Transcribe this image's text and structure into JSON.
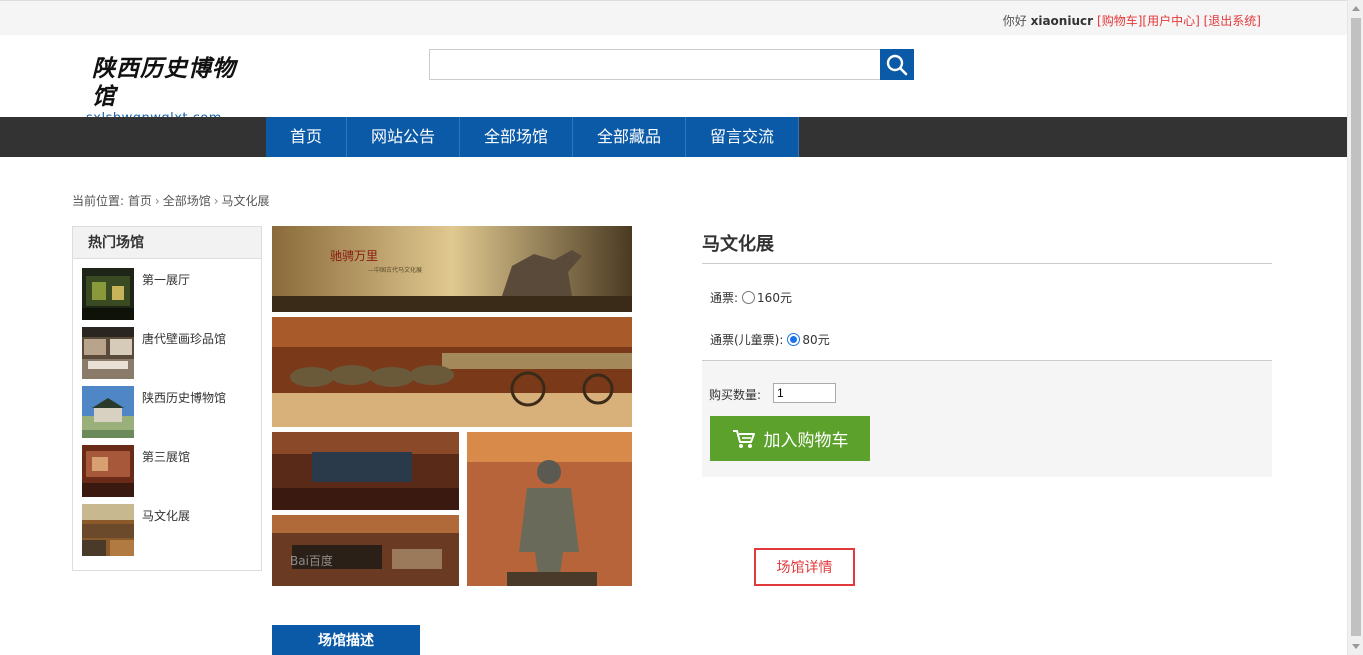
{
  "topbar": {
    "greeting": "你好",
    "username": "xiaoniucr",
    "links": [
      "[购物车]",
      "[用户中心]",
      "[退出系统]"
    ]
  },
  "logo": {
    "cn": "陕西历史博物馆",
    "en": "sxlsbwgpwglxt.com"
  },
  "search": {
    "value": "",
    "placeholder": "",
    "icon": "search-icon"
  },
  "nav": {
    "items": [
      "首页",
      "网站公告",
      "全部场馆",
      "全部藏品",
      "留言交流"
    ]
  },
  "breadcrumb": {
    "prefix": "当前位置:",
    "items": [
      "首页",
      "全部场馆",
      "马文化展"
    ]
  },
  "sidebar": {
    "title": "热门场馆",
    "items": [
      {
        "label": "第一展厅"
      },
      {
        "label": "唐代壁画珍品馆"
      },
      {
        "label": "陕西历史博物馆"
      },
      {
        "label": "第三展馆"
      },
      {
        "label": "马文化展"
      }
    ]
  },
  "gallery": {
    "banner_text": "驰骋万里",
    "banner_sub": "—中国古代马文化展",
    "watermark": "Bai百度"
  },
  "product": {
    "title": "马文化展",
    "options": [
      {
        "label": "通票:",
        "price": "160元",
        "selected": false
      },
      {
        "label": "通票(儿童票):",
        "price": "80元",
        "selected": true
      }
    ],
    "quantity_label": "购买数量:",
    "quantity_value": "1",
    "add_to_cart": "加入购物车",
    "cart_icon": "cart-icon"
  },
  "tabs": {
    "detail": "场馆详情",
    "description": "场馆描述"
  },
  "colors": {
    "brand_blue": "#0b5aa8",
    "accent_red": "#e4393c",
    "cart_green": "#5ba12b",
    "nav_dark": "#333333"
  }
}
